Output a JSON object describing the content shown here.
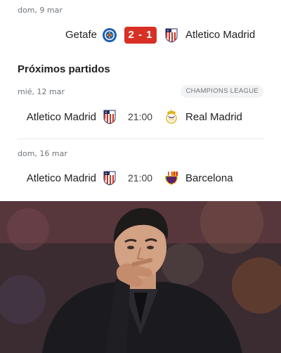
{
  "results": {
    "date": "dom, 9 mar",
    "home_team": "Getafe",
    "away_team": "Atletico Madrid",
    "score": "2 - 1",
    "home_crest": "getafe-crest-icon",
    "away_crest": "atletico-madrid-crest-icon"
  },
  "upcoming": {
    "title": "Próximos partidos",
    "matches": [
      {
        "date": "mié, 12 mar",
        "competition": "CHAMPIONS LEAGUE",
        "home_team": "Atletico Madrid",
        "time": "21:00",
        "away_team": "Real Madrid",
        "home_crest": "atletico-madrid-crest-icon",
        "away_crest": "real-madrid-crest-icon"
      },
      {
        "date": "dom, 16 mar",
        "home_team": "Atletico Madrid",
        "time": "21:00",
        "away_team": "Barcelona",
        "home_crest": "atletico-madrid-crest-icon",
        "away_crest": "barcelona-crest-icon"
      }
    ]
  },
  "colors": {
    "score_badge": "#d93025",
    "atletico_red": "#cb3524",
    "atletico_blue": "#272e61",
    "getafe_blue": "#1f5fb0",
    "barca_blue": "#1c3c8c",
    "barca_red": "#a50044"
  },
  "photo": {
    "subject": "man in dark suit with hand on chin"
  }
}
